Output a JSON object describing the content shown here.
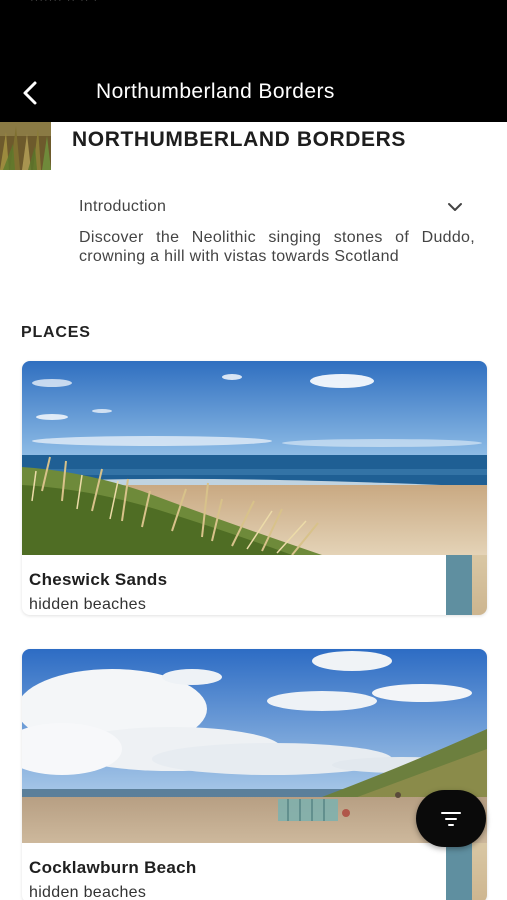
{
  "header": {
    "status_text": "·······  ·· ·· ·",
    "title": "Northumberland Borders",
    "back_icon": "chevron-left-icon"
  },
  "region": {
    "heading": "NORTHUMBERLAND BORDERS",
    "intro_label": "Introduction",
    "intro_toggle_icon": "chevron-down-icon",
    "intro_text": "Discover the Neolithic singing stones of Duddo, crowning a hill with vistas towards Scotland"
  },
  "places": {
    "label": "PLACES",
    "items": [
      {
        "name": "Cheswick Sands",
        "category": "hidden beaches"
      },
      {
        "name": "Cocklawburn Beach",
        "category": "hidden beaches"
      }
    ]
  },
  "fab": {
    "icon": "filter-icon"
  },
  "colors": {
    "topbar": "#000000",
    "accent": "#5f8fa0",
    "fab": "#0a0a0a"
  }
}
